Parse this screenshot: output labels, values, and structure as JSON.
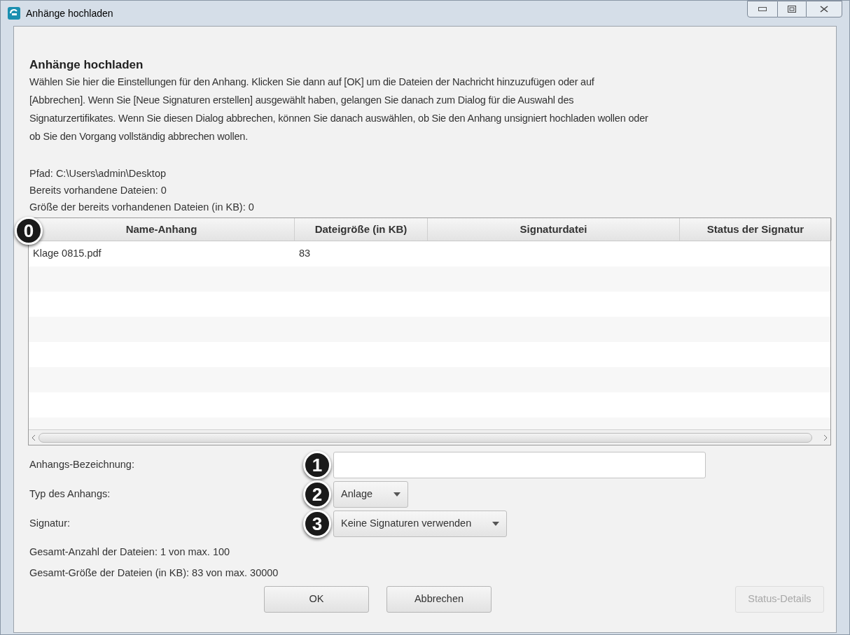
{
  "window": {
    "title": "Anhänge hochladen"
  },
  "heading": "Anhänge hochladen",
  "description_lines": [
    "Wählen Sie hier die Einstellungen für den Anhang. Klicken Sie dann auf [OK] um die Dateien der Nachricht hinzuzufügen oder auf",
    "[Abbrechen]. Wenn Sie [Neue Signaturen erstellen] ausgewählt haben, gelangen Sie danach zum Dialog für die Auswahl des",
    "Signaturzertifikates. Wenn Sie diesen Dialog abbrechen, können Sie danach auswählen, ob Sie den Anhang unsigniert hochladen wollen oder",
    "ob Sie den Vorgang vollständig abbrechen wollen."
  ],
  "info_lines": [
    "Pfad: C:\\Users\\admin\\Desktop",
    "Bereits vorhandene Dateien: 0",
    "Größe der bereits vorhandenen Dateien (in KB): 0"
  ],
  "table": {
    "callout": "0",
    "columns": [
      "Name-Anhang",
      "Dateigröße (in KB)",
      "Signaturdatei",
      "Status der Signatur"
    ],
    "rows": [
      [
        "Klage 0815.pdf",
        "83"
      ]
    ]
  },
  "form": [
    {
      "kind": "input",
      "callout": "1",
      "label": "Anhangs-Bezeichnung:"
    },
    {
      "kind": "select",
      "callout": "2",
      "label": "Typ des Anhangs:",
      "value": "Anlage"
    },
    {
      "kind": "select",
      "callout": "3",
      "label": "Signatur:",
      "value": "Keine Signaturen verwenden"
    }
  ],
  "totals": [
    "Gesamt-Anzahl der Dateien: 1 von max. 100",
    "Gesamt-Größe der Dateien (in KB): 83 von max. 30000"
  ],
  "buttons": [
    {
      "label": "OK",
      "disabled": false
    },
    {
      "label": "Abbrechen",
      "disabled": false
    },
    {
      "label": "Status-Details",
      "disabled": true
    }
  ]
}
